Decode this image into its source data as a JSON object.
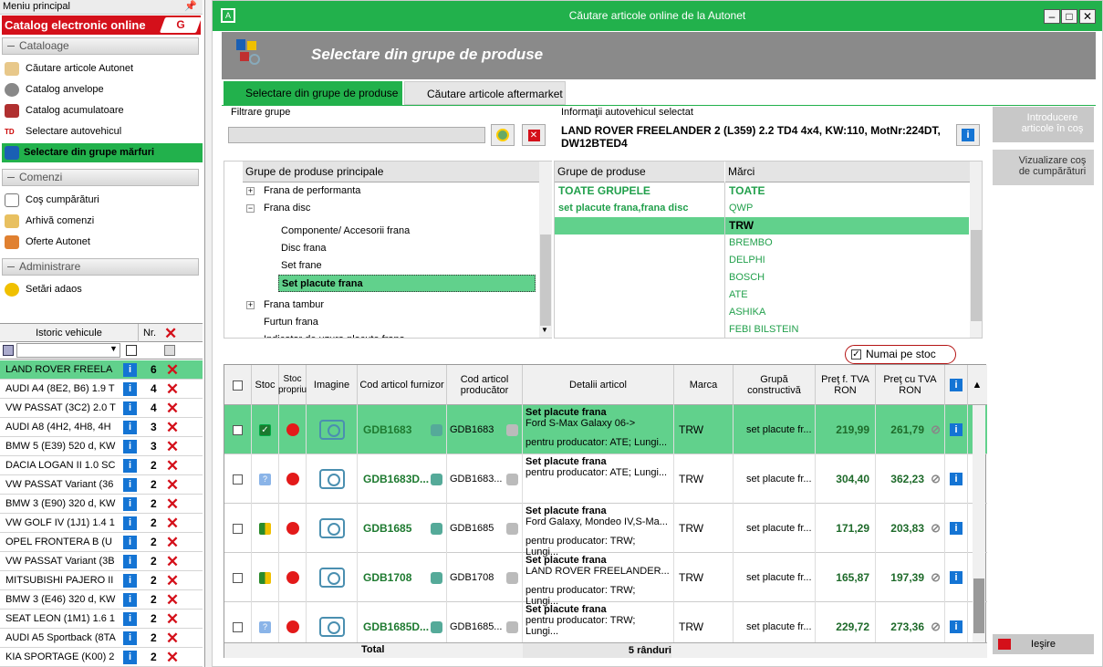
{
  "sidebar": {
    "menu_title": "Meniu principal",
    "catalog_label": "Catalog electronic online",
    "sections": {
      "cataloage": "Cataloage",
      "comenzi": "Comenzi",
      "administrare": "Administrare"
    },
    "items": [
      {
        "label": "Căutare articole Autonet"
      },
      {
        "label": "Catalog anvelope"
      },
      {
        "label": "Catalog acumulatoare"
      },
      {
        "label": "Selectare autovehicul"
      },
      {
        "label": "Selectare din grupe mărfuri"
      },
      {
        "label": "Coş cumpărături"
      },
      {
        "label": "Arhivă comenzi"
      },
      {
        "label": "Oferte Autonet"
      },
      {
        "label": "Setări adaos"
      }
    ],
    "history": {
      "header_name": "Istoric vehicule",
      "header_count": "Nr.",
      "rows": [
        {
          "name": "LAND ROVER FREELA",
          "count": "6"
        },
        {
          "name": "AUDI A4 (8E2, B6) 1.9 T",
          "count": "4"
        },
        {
          "name": "VW PASSAT (3C2) 2.0 T",
          "count": "4"
        },
        {
          "name": "AUDI A8 (4H2, 4H8, 4H",
          "count": "3"
        },
        {
          "name": "BMW 5 (E39) 520 d, KW",
          "count": "3"
        },
        {
          "name": "DACIA LOGAN II 1.0 SC",
          "count": "2"
        },
        {
          "name": "VW PASSAT Variant (36",
          "count": "2"
        },
        {
          "name": "BMW 3 (E90) 320 d, KW",
          "count": "2"
        },
        {
          "name": "VW GOLF IV (1J1) 1.4 1",
          "count": "2"
        },
        {
          "name": "OPEL FRONTERA B (U",
          "count": "2"
        },
        {
          "name": "VW PASSAT Variant (3B",
          "count": "2"
        },
        {
          "name": "MITSUBISHI PAJERO II",
          "count": "2"
        },
        {
          "name": "BMW 3 (E46) 320 d, KW",
          "count": "2"
        },
        {
          "name": "SEAT LEON (1M1) 1.6 1",
          "count": "2"
        },
        {
          "name": "AUDI A5 Sportback (8TA",
          "count": "2"
        },
        {
          "name": "KIA SPORTAGE (K00) 2",
          "count": "2"
        }
      ]
    }
  },
  "window": {
    "title": "Căutare articole online de la Autonet",
    "banner_title": "Selectare din grupe de produse",
    "tabs": [
      "Selectare din grupe de produse",
      "Căutare articole aftermarket"
    ],
    "filter_label": "Filtrare grupe",
    "vehicle_info_label": "Informaţii autovehicul selectat",
    "vehicle_info": "LAND ROVER FREELANDER 2 (L359) 2.2 TD4 4x4, KW:110, MotNr:224DT, DW12BTED4",
    "tree": {
      "header": "Grupe de produse principale",
      "items": [
        "Frana de performanta",
        "Frana disc",
        "Componente/ Accesorii frana",
        "Disc frana",
        "Set frane",
        "Set placute frana",
        "Frana tambur",
        "Furtun frana",
        "Indicator de uzura placute frana"
      ]
    },
    "groups_header": "Grupe de produse",
    "brands_header": "Mărci",
    "groups": [
      "TOATE GRUPELE",
      "set placute frana,frana disc"
    ],
    "brands": [
      "TOATE",
      "QWP",
      "TRW",
      "BREMBO",
      "DELPHI",
      "BOSCH",
      "ATE",
      "ASHIKA",
      "FEBI BILSTEIN"
    ],
    "stock_only_label": "Numai pe stoc",
    "right_buttons": {
      "add_to_cart": "Introducere articole în coş",
      "view_cart": "Vizualizare coş de cumpărături",
      "exit": "Ieşire"
    }
  },
  "grid": {
    "headers": [
      "Stoc",
      "Stoc propriu",
      "Imagine",
      "Cod articol furnizor",
      "Cod articol producător",
      "Detalii articol",
      "Marca",
      "Grupă constructivă",
      "Preţ f. TVA RON",
      "Preţ cu TVA RON"
    ],
    "rows": [
      {
        "code": "GDB1683",
        "prod": "GDB1683",
        "title": "Set placute frana",
        "line1": "Ford S-Max Galaxy 06->",
        "line2": "pentru producator: ATE; Lungi...",
        "brand": "TRW",
        "group": "set placute fr...",
        "price": "219,99",
        "price_vat": "261,79",
        "stock": "check"
      },
      {
        "code": "GDB1683D...",
        "prod": "GDB1683...",
        "title": "Set placute frana",
        "line1": "pentru producator: ATE; Lungi...",
        "line2": "",
        "brand": "TRW",
        "group": "set placute fr...",
        "price": "304,40",
        "price_vat": "362,23",
        "stock": "question"
      },
      {
        "code": "GDB1685",
        "prod": "GDB1685",
        "title": "Set placute frana",
        "line1": "Ford Galaxy, Mondeo IV,S-Ma...",
        "line2": "pentru producator: TRW; Lungi...",
        "brand": "TRW",
        "group": "set placute fr...",
        "price": "171,29",
        "price_vat": "203,83",
        "stock": "partial"
      },
      {
        "code": "GDB1708",
        "prod": "GDB1708",
        "title": "Set placute frana",
        "line1": "LAND ROVER FREELANDER...",
        "line2": "pentru producator: TRW; Lungi...",
        "brand": "TRW",
        "group": "set placute fr...",
        "price": "165,87",
        "price_vat": "197,39",
        "stock": "partial"
      },
      {
        "code": "GDB1685D...",
        "prod": "GDB1685...",
        "title": "Set placute frana",
        "line1": "pentru producator: TRW; Lungi...",
        "line2": "",
        "brand": "TRW",
        "group": "set placute fr...",
        "price": "229,72",
        "price_vat": "273,36",
        "stock": "question"
      }
    ],
    "footer_total": "Total",
    "footer_rows": "5 rânduri"
  },
  "colors": {
    "accent": "#22b14c",
    "selected_row": "#61d18c",
    "brand_red": "#d4101a",
    "info_blue": "#1474d4"
  }
}
